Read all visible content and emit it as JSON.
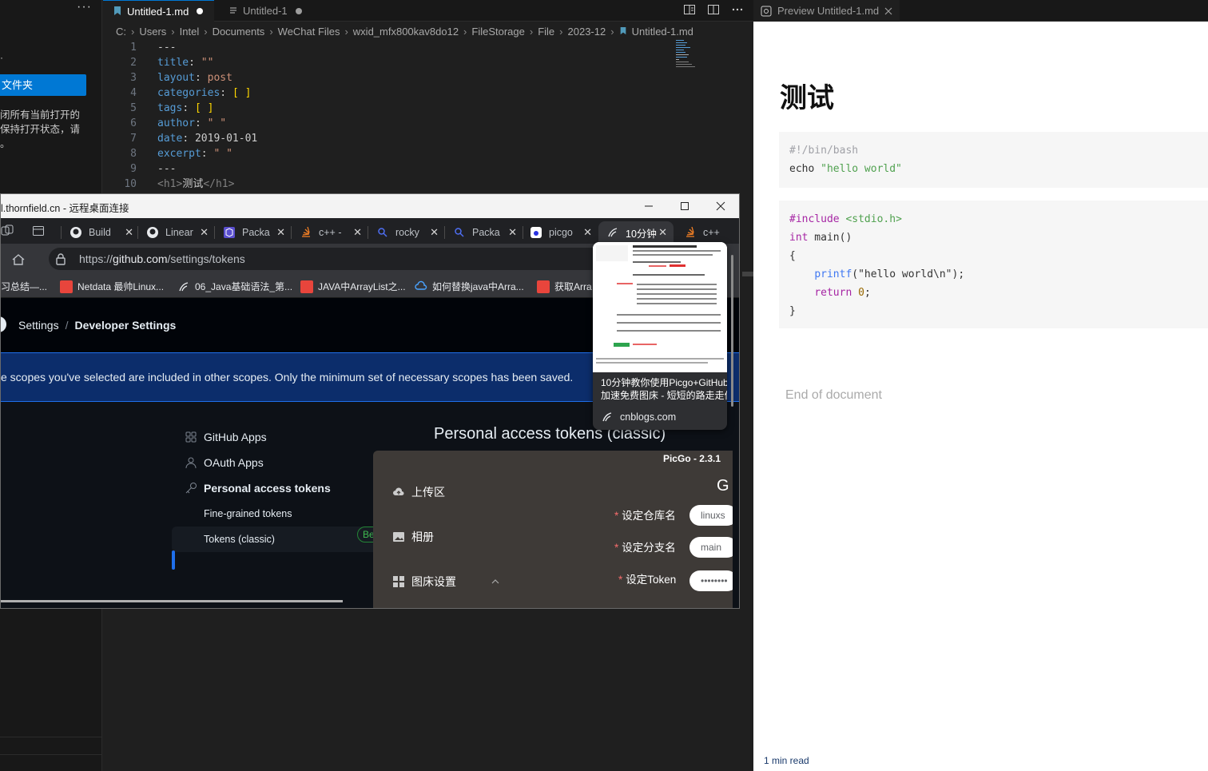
{
  "sidebar": {
    "more_label": "···",
    "bullet": "·",
    "open_folder_label": "文件夹",
    "message_lines": [
      "闭所有当前打开的",
      "保持打开状态，请",
      "。"
    ]
  },
  "editor": {
    "tabs": [
      {
        "label": "Untitled-1.md",
        "active": true
      },
      {
        "label": "Untitled-1",
        "active": false
      }
    ],
    "breadcrumb": [
      "C:",
      "Users",
      "Intel",
      "Documents",
      "WeChat Files",
      "wxid_mfx800kav8do12",
      "FileStorage",
      "File",
      "2023-12",
      "Untitled-1.md"
    ],
    "code_lines": [
      {
        "n": "1",
        "key": "---",
        "val": ""
      },
      {
        "n": "2",
        "key": "title",
        "val": "\"\""
      },
      {
        "n": "3",
        "key": "layout",
        "val": "post"
      },
      {
        "n": "4",
        "key": "categories",
        "val": "[ ]"
      },
      {
        "n": "5",
        "key": "tags",
        "val": "[ ]"
      },
      {
        "n": "6",
        "key": "author",
        "val": "\" \""
      },
      {
        "n": "7",
        "key": "date",
        "val": "2019-01-01"
      },
      {
        "n": "8",
        "key": "excerpt",
        "val": "\" \""
      },
      {
        "n": "9",
        "key": "---",
        "val": ""
      },
      {
        "n": "10",
        "key": "<h1>测试</h1>",
        "val": ""
      }
    ],
    "line10": {
      "open": "<h1>",
      "text": "测试",
      "close": "</h1>"
    }
  },
  "preview": {
    "tab_label": "Preview Untitled-1.md",
    "heading": "测试",
    "code_block_1": [
      "#!/bin/bash",
      "echo \"hello world\""
    ],
    "code_block_2": {
      "include": "#include",
      "header": "<stdio.h>",
      "int_kw": "int",
      "main_sig": " main()",
      "open_brace": "{",
      "printf_fn": "printf",
      "printf_args": "(\"hello world\\n\");",
      "return_kw": "return",
      "zero": "0",
      "semicolon": ";",
      "close_brace": "}"
    },
    "end_text": "End of document",
    "read_time": "1 min read"
  },
  "rdp": {
    "title": "l.thornfield.cn - 远程桌面连接",
    "browser": {
      "tabs": [
        {
          "label": "Build",
          "icon": "github-icon"
        },
        {
          "label": "Linear",
          "icon": "github-icon"
        },
        {
          "label": "Packa",
          "icon": "package-icon"
        },
        {
          "label": "c++ -",
          "icon": "stack-icon"
        },
        {
          "label": "rocky",
          "icon": "search-icon"
        },
        {
          "label": "Packa",
          "icon": "search-icon"
        },
        {
          "label": "picgo",
          "icon": "baidu-icon"
        },
        {
          "label": "10分钟",
          "icon": "cnblogs-icon",
          "active": true
        },
        {
          "label": "c++",
          "icon": "stack-icon"
        }
      ],
      "url_prefix": "https://",
      "url_domain": "github.com",
      "url_path": "/settings/tokens",
      "bookmarks": [
        "习总结—...",
        "Netdata 最帅Linux...",
        "06_Java基础语法_第...",
        "JAVA中ArrayList之...",
        "如何替换java中Arra...",
        "获取Arra"
      ]
    },
    "github": {
      "crumb_settings": "Settings",
      "crumb_sep": "/",
      "crumb_dev": "Developer Settings",
      "banner": "e scopes you've selected are included in other scopes. Only the minimum set of necessary scopes has been saved.",
      "nav": {
        "github_apps": "GitHub Apps",
        "oauth_apps": "OAuth Apps",
        "pat": "Personal access tokens",
        "fine_grained": "Fine-grained tokens",
        "beta": "Be",
        "classic": "Tokens (classic)"
      },
      "heading": "Personal access tokens (classic)"
    },
    "hovercard": {
      "title_line1": "10分钟教你使用Picgo+GitHub",
      "title_line2": "加速免费图床 - 短短的路走走停",
      "domain": "cnblogs.com"
    },
    "picgo": {
      "version": "PicGo - 2.3.1",
      "nav": [
        "上传区",
        "相册",
        "图床设置"
      ],
      "g_letter": "G",
      "fields": [
        {
          "label": "设定仓库名",
          "value": "linuxs"
        },
        {
          "label": "设定分支名",
          "value": "main"
        },
        {
          "label": "设定Token",
          "value": "••••••••"
        }
      ],
      "required_mark": "*"
    }
  }
}
